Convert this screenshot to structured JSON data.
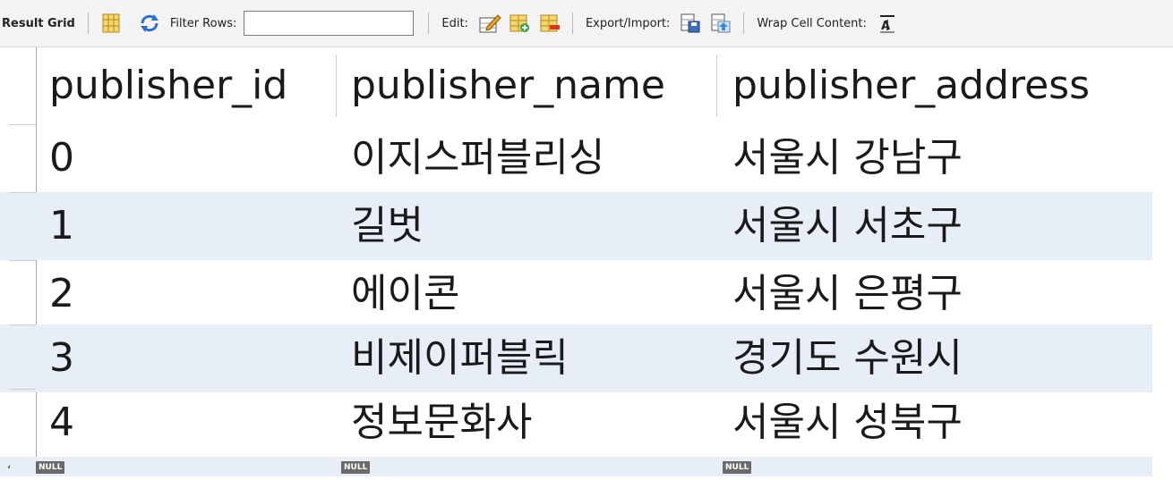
{
  "toolbar": {
    "result_grid_label": "Result Grid",
    "filter_rows_label": "Filter Rows:",
    "filter_rows_value": "",
    "edit_label": "Edit:",
    "export_import_label": "Export/Import:",
    "wrap_cell_label": "Wrap Cell Content:",
    "icons": [
      "grid-layout-icon",
      "refresh-icon",
      "edit-row-icon",
      "add-row-icon",
      "delete-row-icon",
      "export-icon",
      "import-icon",
      "wrap-text-icon"
    ]
  },
  "grid": {
    "columns": [
      "publisher_id",
      "publisher_name",
      "publisher_address"
    ],
    "rows": [
      [
        "0",
        "이지스퍼블리싱",
        "서울시 강남구"
      ],
      [
        "1",
        "길벗",
        "서울시 서초구"
      ],
      [
        "2",
        "에이콘",
        "서울시 은평구"
      ],
      [
        "3",
        "비제이퍼블릭",
        "경기도 수원시"
      ],
      [
        "4",
        "정보문화사",
        "서울시 성북구"
      ]
    ],
    "new_row": [
      "NULL",
      "NULL",
      "NULL"
    ],
    "row_marker": "‘"
  },
  "colors": {
    "toolbar_bg": "#f3f3f3",
    "alt_row_bg": "#e8eef8",
    "null_badge_bg": "#6a6a6a"
  }
}
